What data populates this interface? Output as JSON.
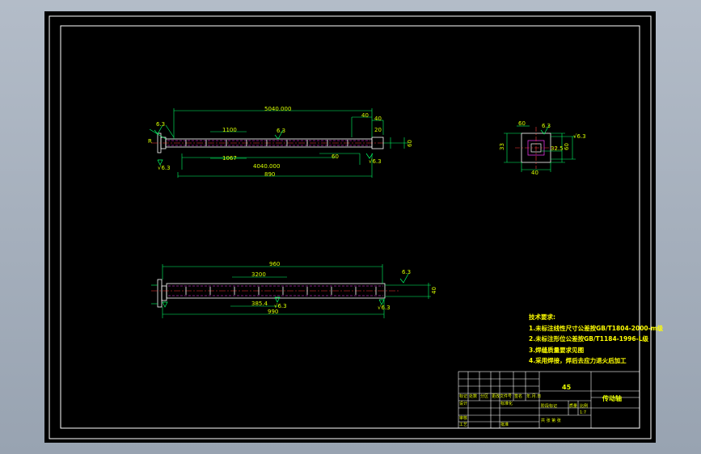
{
  "drawing": {
    "colors": {
      "frame": "#ffffff",
      "outline": "#ffffff",
      "dimension": "#00ff66",
      "centerline": "#ff3b3b",
      "hidden": "#ff3bff",
      "text": "#d8ff00",
      "background": "#000000"
    },
    "top_view": {
      "dim_overall": "5040.000",
      "dim_bottom_total": "890",
      "dim_span": "4040.000",
      "dim_left_pitch": "1100",
      "dim_left_bottom": "1067",
      "dim_right_small": "40",
      "dim_right_40": "40",
      "dim_right_10": "20",
      "dim_right_60": "60",
      "dim_right_height": "60",
      "roughness_left": "6.3",
      "roughness_mid": "6.3",
      "surface_marks": [
        "R",
        "√6.3",
        "√6.3"
      ]
    },
    "section_view": {
      "dim_top": "60",
      "dim_right": "32.5",
      "dim_height": "60",
      "dim_left": "33",
      "dim_bottom": "40",
      "roughness_top": "6.3",
      "roughness_side": "√6.3"
    },
    "front_view": {
      "dim_overall": "960",
      "dim_pitch": "3200",
      "dim_bottom_total": "990",
      "dim_small": "385.4",
      "roughness_right": "6.3",
      "surface_mark": "√6.3",
      "right_height": "40",
      "right_note": "√6.3"
    }
  },
  "tech_notes": {
    "heading": "技术要求:",
    "items": [
      "1.未标注线性尺寸公差按GB/T1804-2000-m级",
      "2.未标注形位公差按GB/T1184-1996-L级",
      "3.焊缝质量要求见图",
      "4.采用焊接，焊后去应力退火后加工"
    ]
  },
  "title_block": {
    "material": "45",
    "part_name": "传动轴",
    "scale_label": "比例",
    "scale_value": "1:7",
    "weight_label": "质量",
    "marks_label": "阶段标记",
    "sheet_label": "共  张  第  张",
    "row_labels": [
      "标记",
      "处数",
      "分区",
      "更改文件号",
      "签名",
      "年.月.日"
    ],
    "sign_labels": [
      "设计",
      "标准化",
      "审核",
      "工艺",
      "批准"
    ]
  }
}
